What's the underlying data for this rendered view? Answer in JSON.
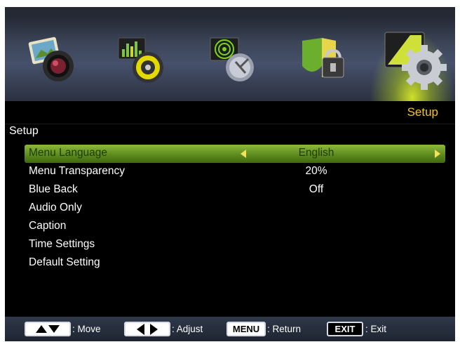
{
  "banner": {
    "icons": [
      {
        "name": "picture-icon"
      },
      {
        "name": "sound-icon"
      },
      {
        "name": "channel-icon"
      },
      {
        "name": "lock-icon"
      },
      {
        "name": "setup-icon",
        "active": true
      }
    ],
    "category_title": "Setup"
  },
  "section_title": "Setup",
  "menu": {
    "items": [
      {
        "label": "Menu Language",
        "value": "English",
        "selected": true
      },
      {
        "label": "Menu Transparency",
        "value": "20%"
      },
      {
        "label": "Blue Back",
        "value": "Off"
      },
      {
        "label": "Audio Only",
        "value": ""
      },
      {
        "label": "Caption",
        "value": ""
      },
      {
        "label": "Time Settings",
        "value": ""
      },
      {
        "label": "Default Setting",
        "value": ""
      }
    ]
  },
  "footer": {
    "move_label": ": Move",
    "adjust_label": ": Adjust",
    "menu_key": "MENU",
    "return_label": ": Return",
    "exit_key": "EXIT",
    "exit_label": ": Exit"
  },
  "colors": {
    "highlight": "#6fa22a",
    "category_title": "#f2c230",
    "arrow": "#f3e25a"
  }
}
